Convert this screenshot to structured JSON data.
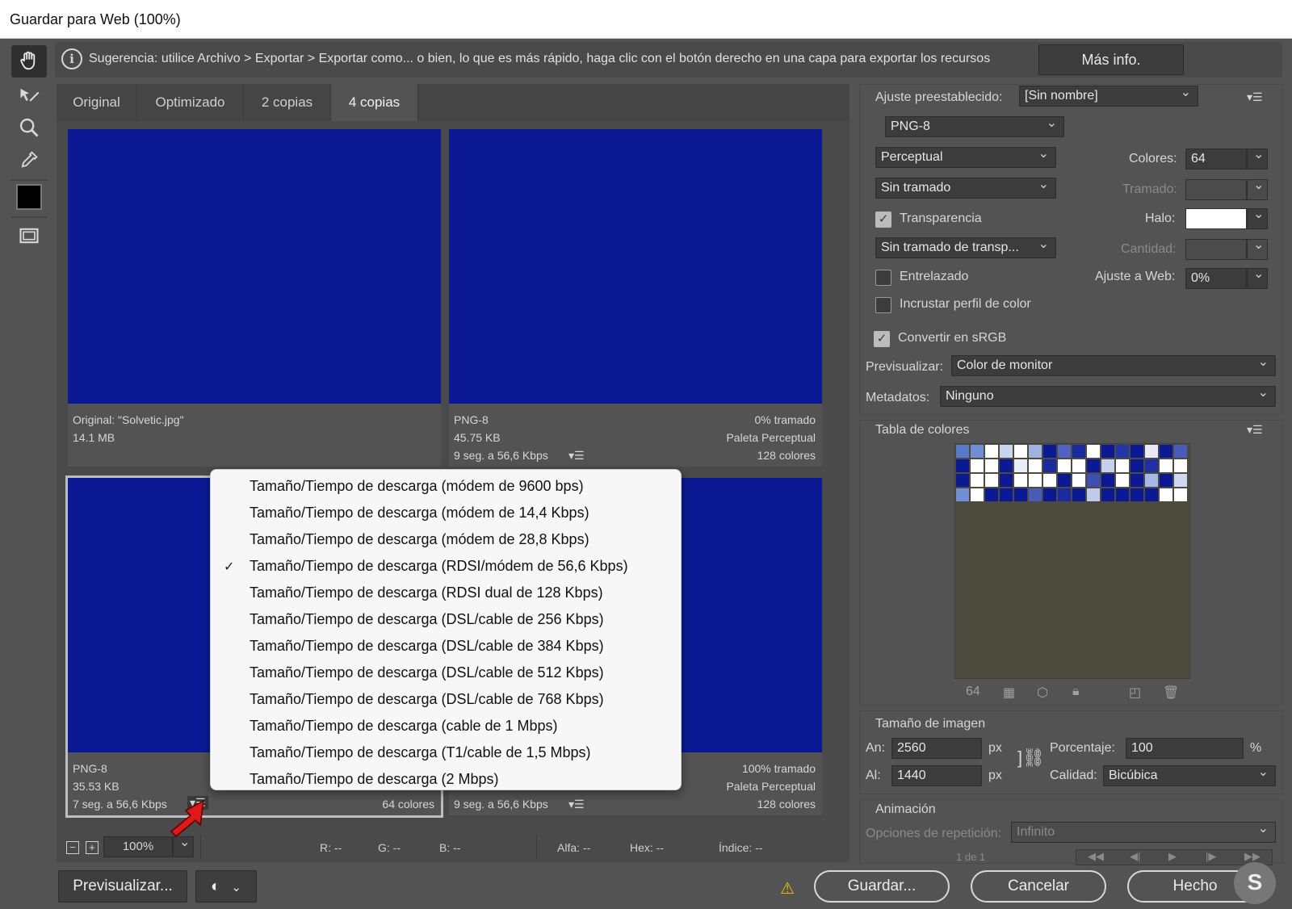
{
  "window": {
    "title": "Guardar para Web (100%)"
  },
  "hint": {
    "text": "Sugerencia: utilice Archivo > Exportar > Exportar como... o bien, lo que es más rápido, haga clic con el botón derecho en una capa para exportar los recursos",
    "more_button": "Más info."
  },
  "tabs": [
    "Original",
    "Optimizado",
    "2 copias",
    "4 copias"
  ],
  "active_tab": "4 copias",
  "preview_colors": {
    "image": "#0b1a94"
  },
  "previews": {
    "top_left": {
      "line1": "Original: \"Solvetic.jpg\"",
      "line2": "14.1 MB"
    },
    "top_right": {
      "format": "PNG-8",
      "size": "45.75 KB",
      "time": "9 seg. a 56,6 Kbps",
      "dither": "0% tramado",
      "palette": "Paleta Perceptual",
      "colors": "128 colores"
    },
    "bottom_left": {
      "format": "PNG-8",
      "size": "35.53 KB",
      "time": "7 seg. a 56,6 Kbps",
      "colors": "64 colores"
    },
    "bottom_right": {
      "time": "9 seg. a 56,6 Kbps",
      "dither": "100% tramado",
      "palette": "Paleta Perceptual",
      "colors": "128 colores"
    }
  },
  "download_menu": {
    "items": [
      "Tamaño/Tiempo de descarga (módem de 9600 bps)",
      "Tamaño/Tiempo de descarga (módem de 14,4 Kbps)",
      "Tamaño/Tiempo de descarga (módem de 28,8 Kbps)",
      "Tamaño/Tiempo de descarga (RDSI/módem de 56,6 Kbps)",
      "Tamaño/Tiempo de descarga (RDSI dual de 128 Kbps)",
      "Tamaño/Tiempo de descarga (DSL/cable de 256 Kbps)",
      "Tamaño/Tiempo de descarga (DSL/cable de 384 Kbps)",
      "Tamaño/Tiempo de descarga (DSL/cable de 512 Kbps)",
      "Tamaño/Tiempo de descarga (DSL/cable de 768 Kbps)",
      "Tamaño/Tiempo de descarga (cable de 1 Mbps)",
      "Tamaño/Tiempo de descarga (T1/cable de 1,5 Mbps)",
      "Tamaño/Tiempo de descarga (2 Mbps)"
    ],
    "checked_index": 3,
    "check_mark": "✓"
  },
  "status": {
    "zoom": "100%",
    "r": "R: --",
    "g": "G: --",
    "b": "B: --",
    "alpha": "Alfa: --",
    "hex": "Hex: --",
    "index": "Índice: --",
    "zoom_out": "−",
    "zoom_in": "+"
  },
  "buttons": {
    "preview": "Previsualizar...",
    "save": "Guardar...",
    "cancel": "Cancelar",
    "done": "Hecho"
  },
  "settings": {
    "preset_label": "Ajuste preestablecido:",
    "preset_value": "[Sin nombre]",
    "format": "PNG-8",
    "reduction": "Perceptual",
    "colors_label": "Colores:",
    "colors_value": "64",
    "dither_algo": "Sin tramado",
    "dither_label": "Tramado:",
    "transparency_label": "Transparencia",
    "transparency_checked": true,
    "halo_label": "Halo:",
    "halo_color": "#ffffff",
    "trans_dither": "Sin tramado de transp...",
    "amount_label": "Cantidad:",
    "interlaced_label": "Entrelazado",
    "interlaced_checked": false,
    "websnap_label": "Ajuste a Web:",
    "websnap_value": "0%",
    "embed_label": "Incrustar perfil de color",
    "embed_checked": false,
    "srgb_label": "Convertir en sRGB",
    "srgb_checked": true,
    "preview_label": "Previsualizar:",
    "preview_value": "Color de monitor",
    "metadata_label": "Metadatos:",
    "metadata_value": "Ninguno"
  },
  "color_table": {
    "title": "Tabla de colores",
    "count": "64",
    "swatches": [
      "#5a78c8",
      "#6f8ed6",
      "#ffffff",
      "#c9d4ee",
      "#ffffff",
      "#9fb2e0",
      "#0b1a94",
      "#4e64c0",
      "#1a2aa0",
      "#ffffff",
      "#0b1a94",
      "#2236a8",
      "#0b1a94",
      "#e6ebf7",
      "#0b1a94",
      "#4a5cb8",
      "#0b1a94",
      "#ffffff",
      "#ffffff",
      "#0b1a94",
      "#e9edf8",
      "#ffffff",
      "#1b2b9e",
      "#ffffff",
      "#ffffff",
      "#0b1a94",
      "#c6d0ec",
      "#ffffff",
      "#0b1a94",
      "#2030a4",
      "#ffffff",
      "#ffffff",
      "#0b1a94",
      "#ffffff",
      "#ffffff",
      "#0b1a94",
      "#ffffff",
      "#ffffff",
      "#ffffff",
      "#0b1a94",
      "#ffffff",
      "#3c50b4",
      "#0b1a94",
      "#ffffff",
      "#0b1a94",
      "#a8b8e4",
      "#0b1a94",
      "#d0d8f0",
      "#6f8ed6",
      "#ffffff",
      "#0b1a94",
      "#0b1a94",
      "#0b1a94",
      "#4a5cb8",
      "#0b1a94",
      "#1a2aa0",
      "#0b1a94",
      "#c0cbec",
      "#0b1a94",
      "#0b1a94",
      "#0b1a94",
      "#0b1a94",
      "#ffffff",
      "#ffffff"
    ]
  },
  "image_size": {
    "title": "Tamaño de imagen",
    "w_label": "An:",
    "w_value": "2560",
    "w_unit": "px",
    "h_label": "Al:",
    "h_value": "1440",
    "h_unit": "px",
    "pct_label": "Porcentaje:",
    "pct_value": "100",
    "pct_unit": "%",
    "quality_label": "Calidad:",
    "quality_value": "Bicúbica"
  },
  "animation": {
    "title": "Animación",
    "loop_label": "Opciones de repetición:",
    "loop_value": "Infinito",
    "frame": "1 de 1"
  }
}
